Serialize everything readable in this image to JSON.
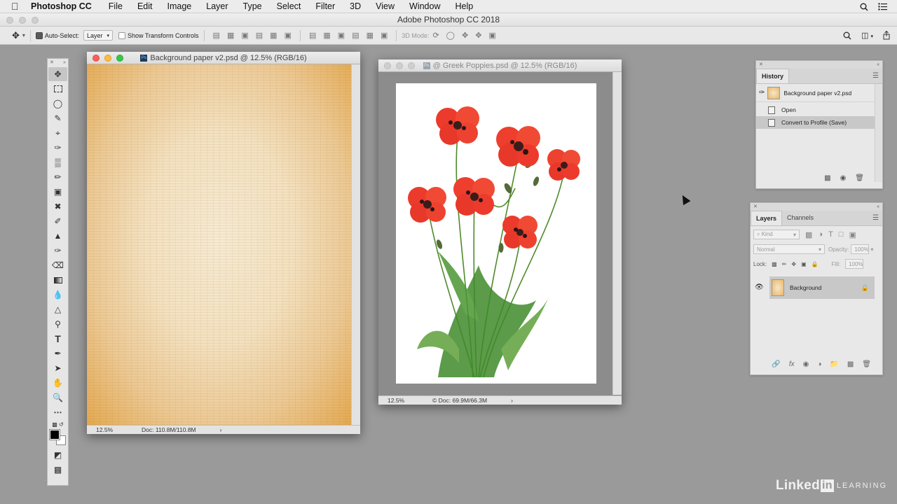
{
  "menubar": {
    "app": "Photoshop CC",
    "items": [
      "File",
      "Edit",
      "Image",
      "Layer",
      "Type",
      "Select",
      "Filter",
      "3D",
      "View",
      "Window",
      "Help"
    ]
  },
  "app_title": "Adobe Photoshop CC 2018",
  "options": {
    "auto_select_label": "Auto-Select:",
    "auto_select_value": "Layer",
    "transform_label": "Show Transform Controls",
    "mode_3d_label": "3D Mode:"
  },
  "doc1": {
    "title": "Background paper v2.psd @ 12.5% (RGB/16)",
    "zoom": "12.5%",
    "doc_size": "Doc: 110.8M/110.8M"
  },
  "doc2": {
    "title": "@ Greek Poppies.psd @ 12.5% (RGB/16)",
    "zoom": "12.5%",
    "doc_size": "© Doc: 69.9M/66.3M"
  },
  "history": {
    "tab": "History",
    "snapshot": "Background paper v2.psd",
    "steps": [
      {
        "label": "Open",
        "selected": false
      },
      {
        "label": "Convert to Profile (Save)",
        "selected": true
      }
    ]
  },
  "layers": {
    "tabs": [
      "Layers",
      "Channels"
    ],
    "kind_placeholder": "Kind",
    "blend_mode": "Normal",
    "opacity_label": "Opacity:",
    "opacity_value": "100%",
    "lock_label": "Lock:",
    "fill_label": "Fill:",
    "fill_value": "100%",
    "layer_name": "Background"
  },
  "watermark": {
    "brand": "Linked",
    "brand_in": "in",
    "learning": "LEARNING"
  },
  "colors": {
    "canvas_bg": "#9a9a9a",
    "poppy_red": "#e8382a",
    "paper": "#f3e1c0"
  }
}
